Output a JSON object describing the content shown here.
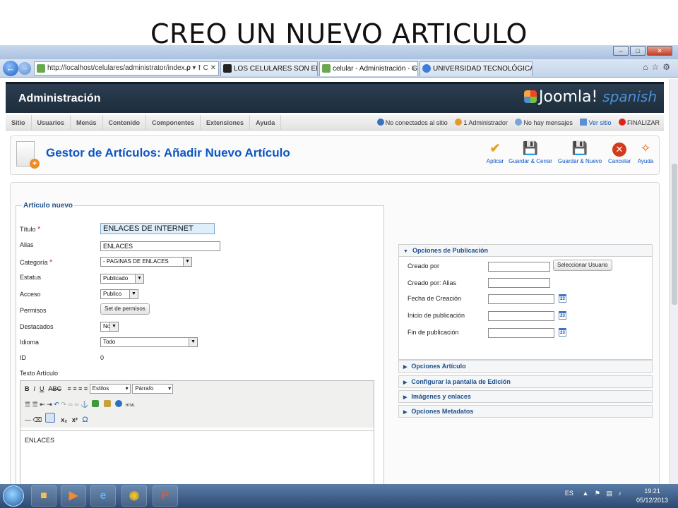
{
  "slide_title": "CREO UN NUEVO ARTICULO",
  "browser": {
    "address": "http://localhost/celulares/administrator/index.p",
    "address_tools": "ρ ▾ ⭡ C ✕",
    "tabs": [
      {
        "label": "LOS CELULARES SON EL DIABLO",
        "active": false
      },
      {
        "label": "celular - Administración - G...",
        "active": true
      },
      {
        "label": "UNIVERSIDAD TECNOLÓGICA ...",
        "active": false
      }
    ],
    "tab_close": "×"
  },
  "header": {
    "admin_label": "Administración",
    "joomla_brand": "Joomla!",
    "joomla_suffix": "spanish"
  },
  "menu": {
    "items": [
      "Sitio",
      "Usuarios",
      "Menús",
      "Contenido",
      "Componentes",
      "Extensiones",
      "Ayuda"
    ],
    "status": {
      "not_connected": "No conectados al sitio",
      "admins": "1 Administrador",
      "messages": "No hay mensajes",
      "view_site": "Ver sitio",
      "finish": "FINALIZAR"
    }
  },
  "toolbar": {
    "title": "Gestor de Artículos: Añadir Nuevo Artículo",
    "buttons": [
      "Aplicar",
      "Guardar & Cerrar",
      "Guardar & Nuevo",
      "Cancelar",
      "Ayuda"
    ]
  },
  "form": {
    "legend": "Artículo nuevo",
    "required_mark": "*",
    "labels": {
      "title": "Título",
      "alias": "Alias",
      "category": "Categoría",
      "status": "Estatus",
      "access": "Acceso",
      "permissions": "Permisos",
      "featured": "Destacados",
      "language": "Idioma",
      "id": "ID",
      "text": "Texto Artículo"
    },
    "values": {
      "title": "ENLACES DE INTERNET",
      "alias": "ENLACES",
      "category": "- PAGINAS DE ENLACES",
      "status": "Publicado",
      "access": "Publico",
      "permissions_button": "Set de permisos",
      "featured": "No",
      "language": "Todo",
      "id": "0"
    }
  },
  "editor": {
    "styles_select": "Estilos",
    "format_select": "Párrafo",
    "html_label": "HTML",
    "content": "ENLACES"
  },
  "publishing": {
    "header": "Opciones de Publicación",
    "fields": [
      "Creado por",
      "Creado por: Alias",
      "Fecha de Creación",
      "Inicio de publicación",
      "Fin de publicación"
    ],
    "select_user_button": "Seleccionar Usuario",
    "calendar_day": "23"
  },
  "panels": [
    "Opciones Artículo",
    "Configurar la pantalla de Edición",
    "Imágenes y enlaces",
    "Opciones Metadatos"
  ],
  "taskbar": {
    "lang": "ES",
    "time": "19:21",
    "date": "05/12/2013"
  }
}
